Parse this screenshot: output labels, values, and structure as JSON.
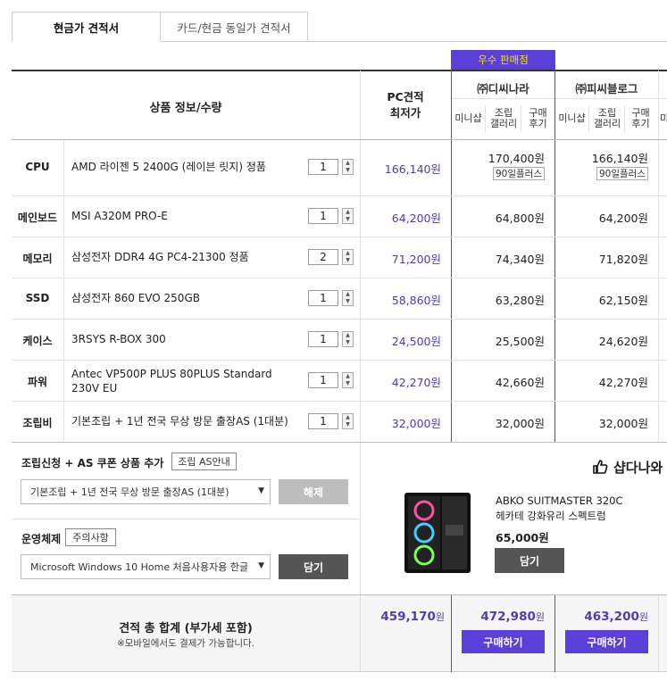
{
  "tabs": [
    {
      "label": "현금가 견적서",
      "active": true
    },
    {
      "label": "카드/현금 동일가 견적서",
      "active": false
    }
  ],
  "header": {
    "product_info": "상품 정보/수량",
    "lowest_price": "PC견적\n최저가",
    "excellent_seller": "우수 판매점",
    "vendor1": "㈜디씨나라",
    "vendor2": "㈜피씨블로그",
    "sub_cols": [
      "미니샵",
      "조립\n갤러리",
      "구매\n후기"
    ]
  },
  "items": [
    {
      "category": "CPU",
      "name": "AMD 라이젠 5 2400G (레이븐 릿지) 정품",
      "qty": "1",
      "lowest": "166,140원",
      "p1": "170,400원",
      "p2": "166,140원",
      "badge1": "90일플러스",
      "badge2": "90일플러스"
    },
    {
      "category": "메인보드",
      "name": "MSI A320M PRO-E",
      "qty": "1",
      "lowest": "64,200원",
      "p1": "64,800원",
      "p2": "64,200원"
    },
    {
      "category": "메모리",
      "name": "삼성전자 DDR4 4G PC4-21300 정품",
      "qty": "2",
      "lowest": "71,200원",
      "p1": "74,340원",
      "p2": "71,820원"
    },
    {
      "category": "SSD",
      "name": "삼성전자 860 EVO 250GB",
      "qty": "1",
      "lowest": "58,860원",
      "p1": "63,280원",
      "p2": "62,150원"
    },
    {
      "category": "케이스",
      "name": "3RSYS R-BOX 300",
      "qty": "1",
      "lowest": "24,500원",
      "p1": "25,500원",
      "p2": "24,620원"
    },
    {
      "category": "파워",
      "name": "Antec VP500P PLUS 80PLUS Standard 230V EU",
      "qty": "1",
      "lowest": "42,270원",
      "p1": "42,660원",
      "p2": "42,270원"
    },
    {
      "category": "조립비",
      "name": "기본조립 + 1년 전국 무상 방문 출장AS (1대분)",
      "qty": "1",
      "lowest": "32,000원",
      "p1": "32,000원",
      "p2": "32,000원"
    }
  ],
  "options": {
    "assembly_title": "조립신청 + AS 쿠폰 상품 추가",
    "assembly_info_btn": "조립 AS안내",
    "assembly_select": "기본조립 + 1년 전국 무상 방문 출장AS (1대분)",
    "release_btn": "해제",
    "os_title": "운영체제",
    "os_notice_btn": "주의사항",
    "os_select": "Microsoft Windows 10 Home 처음사용자용 한글",
    "add_btn": "담기"
  },
  "promo": {
    "title": "샵다나와",
    "product_name": "ABKO SUITMASTER 320C\n헤카테 강화유리 스펙트럼",
    "price": "65,000원",
    "add_btn": "담기"
  },
  "total": {
    "label": "견적 총 합계 (부가세 포함)",
    "note": "※모바일에서도 결제가 가능합니다.",
    "lowest_total": "459,170",
    "v1_total": "472,980",
    "v2_total": "463,200",
    "won": "원",
    "buy_btn": "구매하기"
  },
  "colors": {
    "accent": "#4b3eb0",
    "purple_header": "#5a3fd8",
    "badge_text": "#ffe000"
  }
}
